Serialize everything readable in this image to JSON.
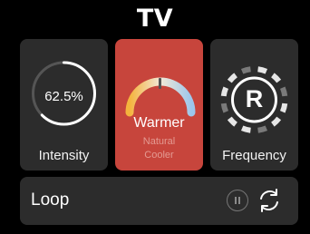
{
  "header": {
    "title": "TV"
  },
  "intensity": {
    "label": "Intensity",
    "value_text": "62.5%",
    "fraction": 0.625
  },
  "temperature": {
    "current": "Warmer",
    "options": [
      "Natural",
      "Cooler"
    ],
    "accent_color": "#c7453c"
  },
  "frequency": {
    "label": "Frequency",
    "letter": "R"
  },
  "loop": {
    "label": "Loop",
    "pause_icon": "pause-icon",
    "repeat_icon": "repeat-icon"
  }
}
